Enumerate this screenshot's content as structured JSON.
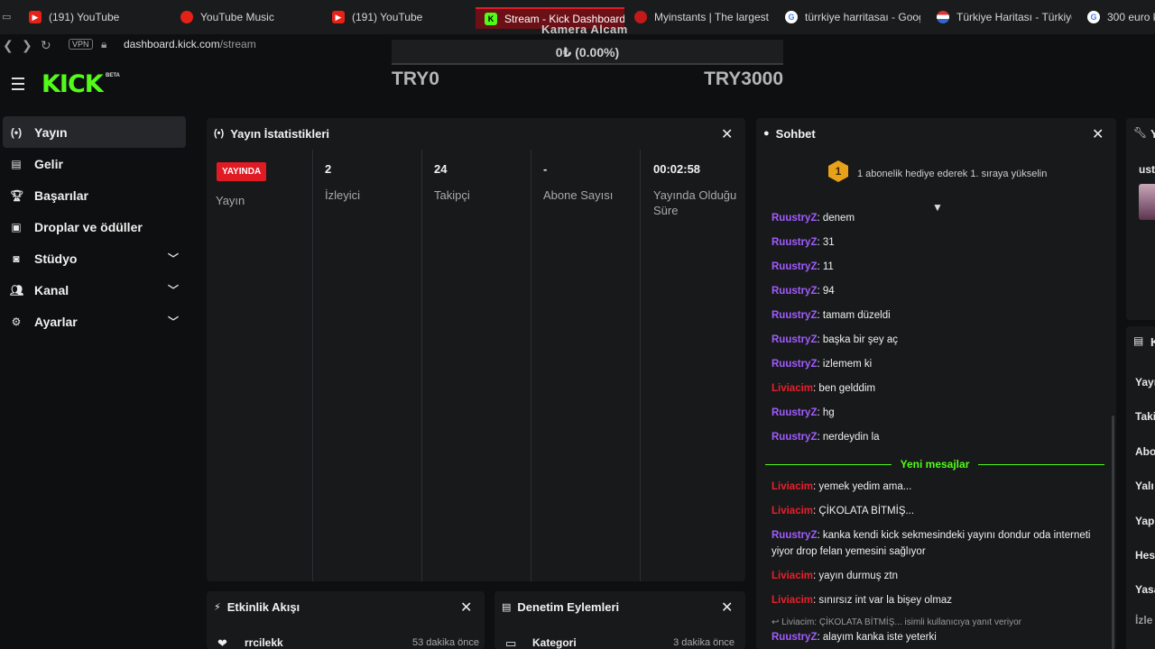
{
  "browser": {
    "tabs": [
      {
        "label": "(191) YouTube",
        "icon": "youtube-icon"
      },
      {
        "label": "YouTube Music",
        "icon": "youtube-music-icon"
      },
      {
        "label": "(191) YouTube",
        "icon": "youtube-icon"
      },
      {
        "label": "Stream - Kick Dashboard",
        "icon": "kick-icon",
        "active": true
      },
      {
        "label": "Myinstants | The largest i",
        "icon": "myinstants-icon"
      },
      {
        "label": "türrkiye harritasaı - Googl",
        "icon": "google-icon"
      },
      {
        "label": "Türkiye Haritası - Türkiye",
        "icon": "flag-icon"
      },
      {
        "label": "300 euro k",
        "icon": "google-icon"
      }
    ],
    "vpn": "VPN",
    "url_host": "dashboard.kick.com",
    "url_path": "/stream"
  },
  "goal": {
    "title": "Kamera Alcam",
    "progress_text": "0₺ (0.00%)",
    "progress": 0,
    "min": "TRY0",
    "max": "TRY3000"
  },
  "header": {
    "logo": "KICK",
    "beta": "BETA"
  },
  "sidebar": {
    "items": [
      {
        "label": "Yayın",
        "icon": "broadcast-icon",
        "active": true
      },
      {
        "label": "Gelir",
        "icon": "chart-icon"
      },
      {
        "label": "Başarılar",
        "icon": "trophy-icon"
      },
      {
        "label": "Droplar ve ödüller",
        "icon": "gift-icon"
      },
      {
        "label": "Stüdyo",
        "icon": "studio-icon",
        "expandable": true
      },
      {
        "label": "Kanal",
        "icon": "users-icon",
        "expandable": true
      },
      {
        "label": "Ayarlar",
        "icon": "gear-icon",
        "expandable": true
      }
    ]
  },
  "stats": {
    "title": "Yayın İstatistikleri",
    "live_badge": "YAYINDA",
    "live_label": "Yayın",
    "viewers": {
      "value": "2",
      "label": "İzleyici"
    },
    "followers": {
      "value": "24",
      "label": "Takipçi"
    },
    "subs": {
      "value": "-",
      "label": "Abone Sayısı"
    },
    "uptime": {
      "value": "00:02:58",
      "label": "Yayında Olduğu Süre"
    }
  },
  "chat": {
    "title": "Sohbet",
    "rank_number": "1",
    "rank_text": "1 abonelik hediye ederek 1. sıraya yükselin",
    "new_messages": "Yeni mesajlar",
    "messages": [
      {
        "user": "RuustryZ",
        "text": "denem"
      },
      {
        "user": "RuustryZ",
        "text": "31"
      },
      {
        "user": "RuustryZ",
        "text": "11"
      },
      {
        "user": "RuustryZ",
        "text": "94"
      },
      {
        "user": "RuustryZ",
        "text": "tamam düzeldi"
      },
      {
        "user": "RuustryZ",
        "text": "başka bir şey aç"
      },
      {
        "user": "RuustryZ",
        "text": "izlemem ki"
      },
      {
        "user": "Liviacim",
        "text": "ben gelddim"
      },
      {
        "user": "RuustryZ",
        "text": "hg"
      },
      {
        "user": "RuustryZ",
        "text": "nerdeydin la"
      },
      {
        "user": "Liviacim",
        "text": "yemek yedim ama..."
      },
      {
        "user": "Liviacim",
        "text": "ÇİKOLATA BİTMİŞ..."
      },
      {
        "user": "RuustryZ",
        "text": "kanka kendi kick sekmesindeki yayını dondur oda interneti yiyor drop felan yemesini sağlıyor"
      },
      {
        "user": "Liviacim",
        "text": "yayın durmuş ztn"
      },
      {
        "user": "Liviacim",
        "text": "sınırsız int var la bişey olmaz"
      },
      {
        "user": "RuustryZ",
        "text": "alayım kanka iste yeterki"
      }
    ],
    "reply_note": "Liviacim: ÇİKOLATA BİTMİŞ... isimli kullanıcıya yanıt veriyor"
  },
  "events": {
    "title": "Etkinlik Akışı",
    "row": {
      "name": "rrcilekk",
      "time": "53 dakika önce"
    }
  },
  "moderation": {
    "title": "Denetim Eylemleri",
    "row": {
      "name": "Kategori",
      "time": "3 dakika önce"
    }
  },
  "right_panel": {
    "top_label": "Y",
    "top_text": "ust",
    "second_label": "K",
    "items": [
      "Yayı",
      "Taki",
      "Abo",
      "Yalı",
      "Yap",
      "Hes",
      "Yasa",
      "İzle"
    ]
  }
}
